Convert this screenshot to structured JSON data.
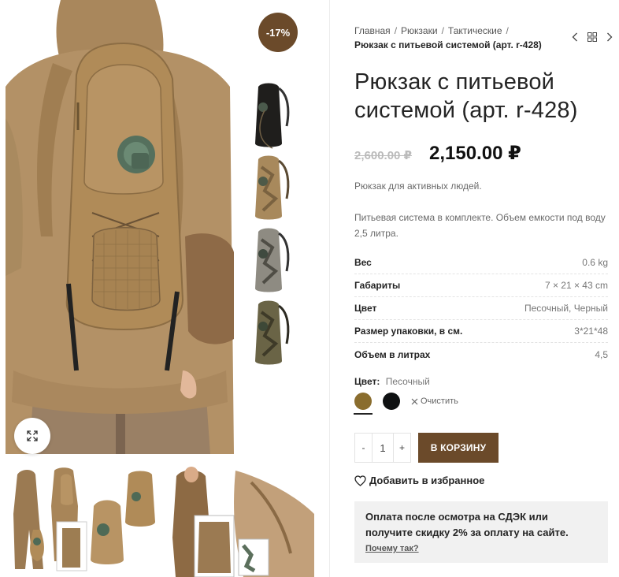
{
  "gallery": {
    "badge": "-17%",
    "zoom_icon": "expand-icon",
    "side_thumbs": [
      {
        "color": "#1f1e1c"
      },
      {
        "color": "#a8895c"
      },
      {
        "color": "#8e8b82"
      },
      {
        "color": "#6a6446"
      }
    ]
  },
  "breadcrumb": {
    "items": [
      "Главная",
      "Рюкзаки",
      "Тактические"
    ],
    "current": "Рюкзак с питьевой системой (арт. r-428)"
  },
  "product": {
    "title": "Рюкзак с питьевой системой (арт. r-428)",
    "old_price": "2,600.00 ₽",
    "new_price": "2,150.00 ₽",
    "short_desc": "Рюкзак для активных людей.",
    "desc": "Питьевая система в комплекте. Объем емкости под воду 2,5 литра."
  },
  "attributes": [
    {
      "name": "Вес",
      "value": "0.6 kg"
    },
    {
      "name": "Габариты",
      "value": "7 × 21 × 43 cm"
    },
    {
      "name": "Цвет",
      "value": "Песочный, Черный"
    },
    {
      "name": "Размер упаковки, в см.",
      "value": "3*21*48"
    },
    {
      "name": "Объем в литрах",
      "value": "4,5"
    }
  ],
  "variation": {
    "label": "Цвет",
    "selected": "Песочный",
    "swatches": [
      {
        "name": "Песочный",
        "color": "#8a6d2e"
      },
      {
        "name": "Черный",
        "color": "#0f1112"
      }
    ],
    "clear_label": "Очистить"
  },
  "cart": {
    "minus": "-",
    "qty": "1",
    "plus": "+",
    "button": "В КОРЗИНУ"
  },
  "wishlist_label": "Добавить в избранное",
  "notice": {
    "text": "Оплата после осмотра на СДЭК или получите скидку 2% за оплату на сайте.",
    "link": "Почему так?"
  },
  "colors": {
    "accent": "#6b4a2a",
    "tan": "#b29268"
  }
}
